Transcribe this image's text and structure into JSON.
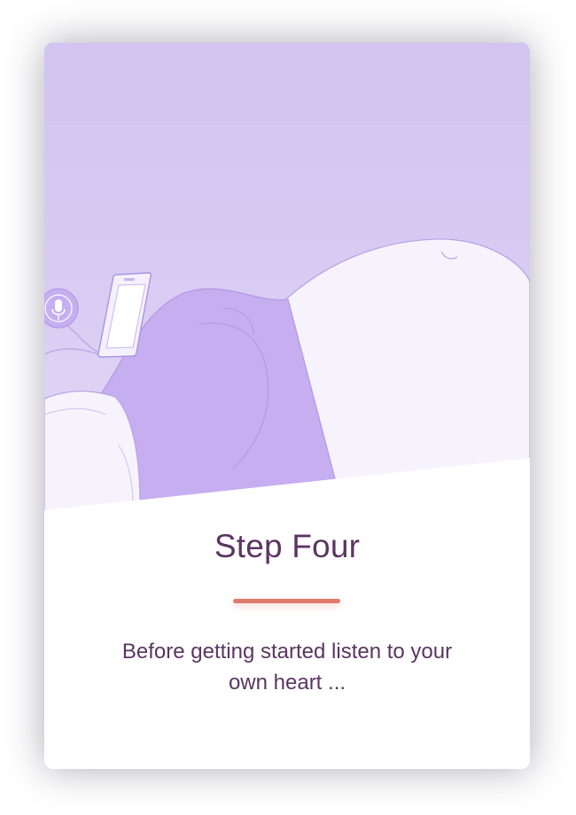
{
  "step": {
    "title": "Step Four",
    "description": "Before getting started listen to your own heart ..."
  },
  "illustration": {
    "subject": "pregnant-belly-with-phone-illustration",
    "icons": [
      "microphone-icon",
      "smartphone-icon"
    ]
  },
  "colors": {
    "hero_background": "#d3c4f1",
    "illustration_purple": "#c6aef0",
    "accent_divider": "#e07a6c",
    "text": "#5b3561",
    "card_background": "#ffffff"
  }
}
